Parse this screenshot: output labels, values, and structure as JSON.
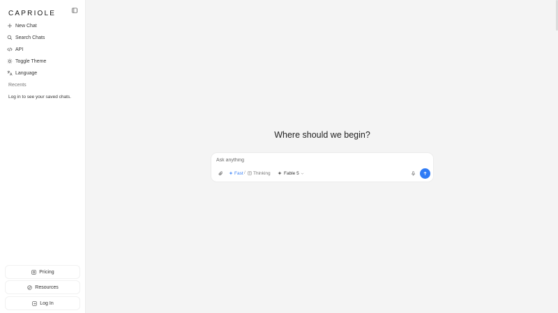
{
  "brand": {
    "logo_text": "CAPRIOLE"
  },
  "sidebar": {
    "nav": [
      {
        "label": "New Chat",
        "icon": "plus-icon"
      },
      {
        "label": "Search Chats",
        "icon": "search-icon"
      },
      {
        "label": "API",
        "icon": "code-icon"
      },
      {
        "label": "Toggle Theme",
        "icon": "sun-icon"
      },
      {
        "label": "Language",
        "icon": "translate-icon"
      }
    ],
    "recents_label": "Recents",
    "recents_hint": "Log in to see your saved chats.",
    "bottom": [
      {
        "label": "Pricing",
        "icon": "pricing-icon"
      },
      {
        "label": "Resources",
        "icon": "resources-icon"
      },
      {
        "label": "Log In",
        "icon": "login-icon"
      }
    ]
  },
  "main": {
    "heading": "Where should we begin?",
    "composer": {
      "placeholder": "Ask anything",
      "mode_fast": "Fast",
      "mode_separator": "/",
      "mode_thinking": "Thinking",
      "model": "Fable 5"
    }
  },
  "colors": {
    "accent": "#2f7bf5",
    "fast_mode": "#3b82f6",
    "background": "#f4f4f4",
    "sidebar": "#ffffff"
  }
}
